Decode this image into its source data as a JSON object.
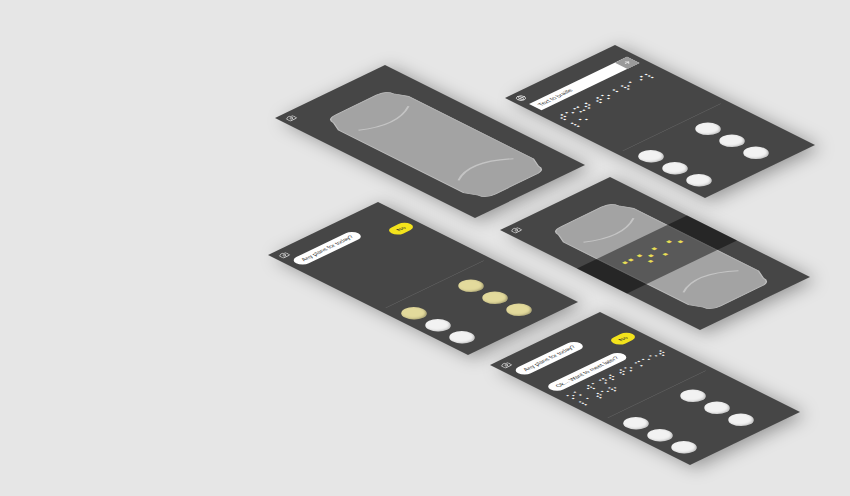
{
  "screens": [
    {
      "kind": "camera",
      "overlay": false
    },
    {
      "kind": "translate",
      "search": {
        "value": "Text to braille"
      },
      "braille": "⠞⠑⠭⠞ ⠞⠕ ⠃⠗⠁⠊⠇⠇⠑",
      "keys": [
        {
          "pressed": false
        },
        {
          "pressed": false
        },
        {
          "pressed": false
        },
        {
          "pressed": false
        },
        {
          "pressed": false
        },
        {
          "pressed": false
        }
      ]
    },
    {
      "kind": "chat",
      "messages": [
        {
          "text": "Any plans for today?",
          "from": "them"
        },
        {
          "text": "No",
          "from": "me"
        }
      ],
      "keys": [
        {
          "pressed": true
        },
        {
          "pressed": true
        },
        {
          "pressed": false
        },
        {
          "pressed": true
        },
        {
          "pressed": false
        },
        {
          "pressed": true
        }
      ]
    },
    {
      "kind": "camera",
      "overlay": true,
      "braille": "⠉⠕⠅⠑"
    },
    {
      "kind": "chat",
      "messages": [
        {
          "text": "Any plans for today?",
          "from": "them"
        },
        {
          "text": "No",
          "from": "me"
        },
        {
          "text": "Ok... Want to meet later?",
          "from": "them"
        }
      ],
      "braille": "⠕⠅ ⠺⠁⠝⠞ ⠞⠕ ⠍⠑⠑⠞ ⠇⠁⠞⠑⠗",
      "keys": [
        {
          "pressed": false
        },
        {
          "pressed": false
        },
        {
          "pressed": false
        },
        {
          "pressed": false
        },
        {
          "pressed": false
        },
        {
          "pressed": false
        }
      ]
    }
  ]
}
